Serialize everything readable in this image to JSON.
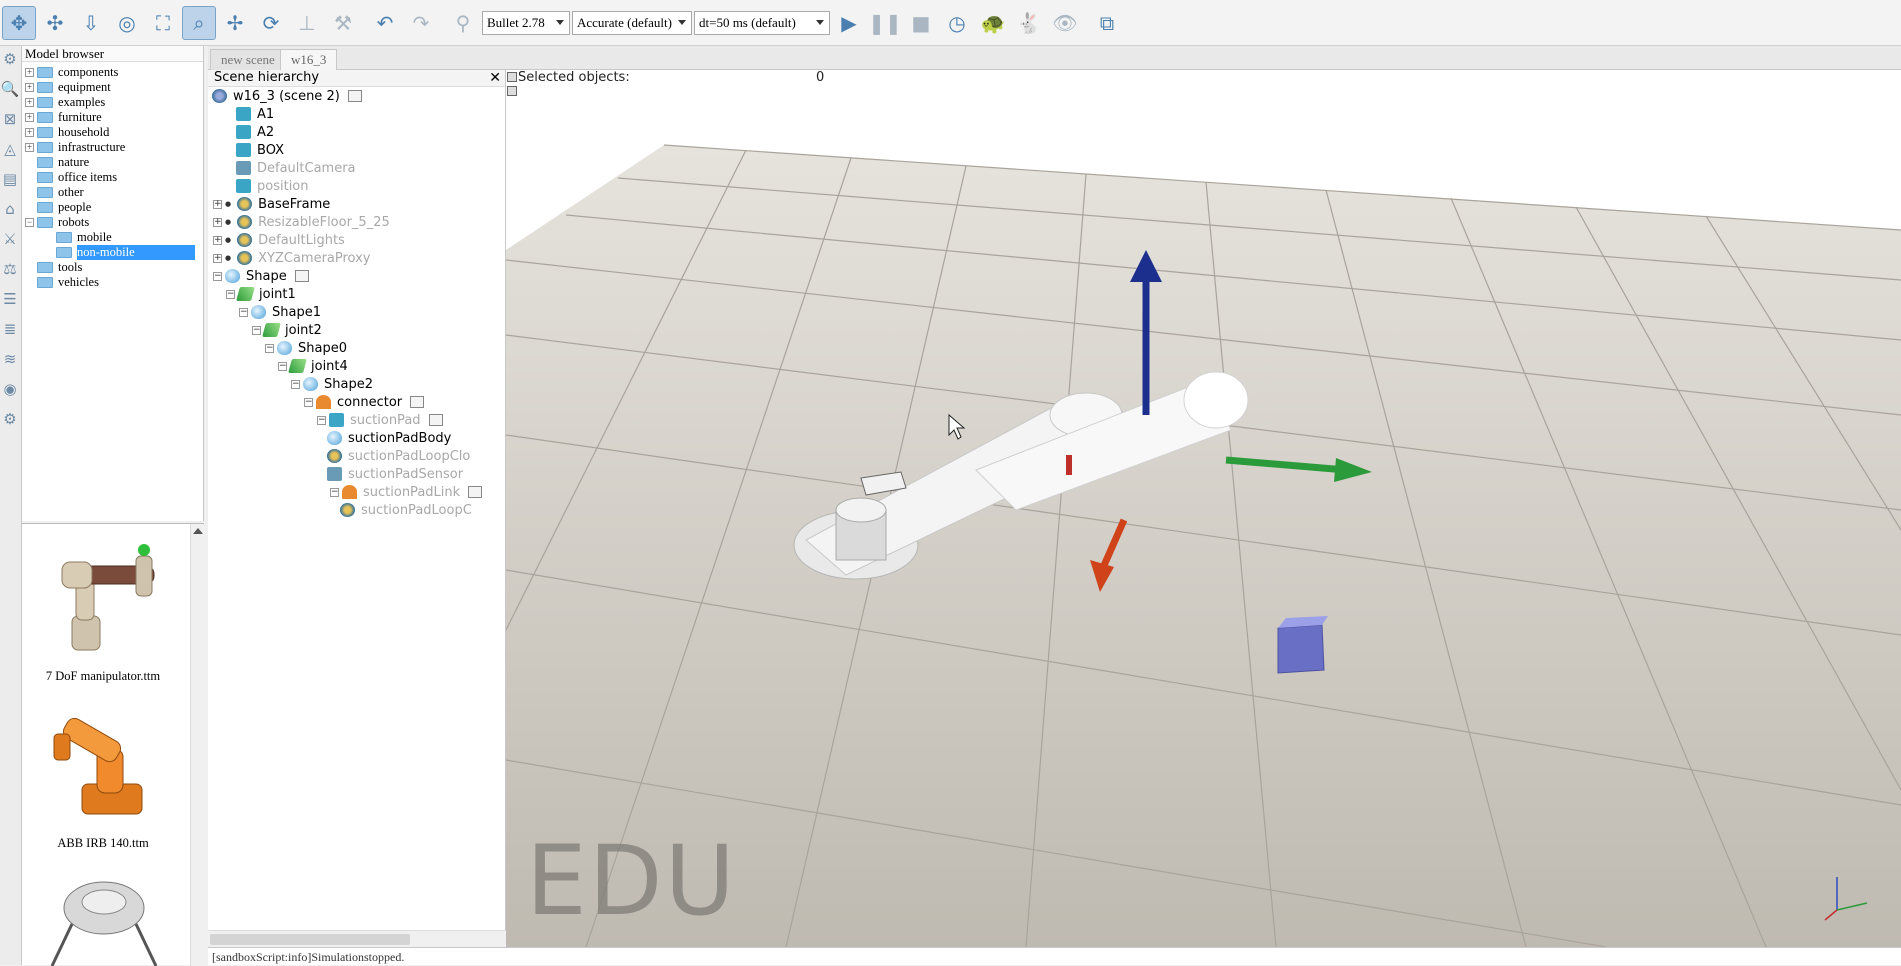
{
  "toolbar": {
    "engine": "Bullet 2.78",
    "accuracy": "Accurate (default)",
    "timestep": "dt=50 ms (default)"
  },
  "model_browser": {
    "title": "Model browser",
    "folders": [
      {
        "label": "components",
        "expandable": true
      },
      {
        "label": "equipment",
        "expandable": true
      },
      {
        "label": "examples",
        "expandable": true
      },
      {
        "label": "furniture",
        "expandable": true
      },
      {
        "label": "household",
        "expandable": true
      },
      {
        "label": "infrastructure",
        "expandable": true
      },
      {
        "label": "nature",
        "expandable": false
      },
      {
        "label": "office items",
        "expandable": false
      },
      {
        "label": "other",
        "expandable": false
      },
      {
        "label": "people",
        "expandable": false
      },
      {
        "label": "robots",
        "expandable": true,
        "expanded": true
      },
      {
        "label": "mobile",
        "child": true
      },
      {
        "label": "non-mobile",
        "child": true,
        "selected": true
      },
      {
        "label": "tools",
        "expandable": false
      },
      {
        "label": "vehicles",
        "expandable": false
      }
    ],
    "previews": [
      {
        "label": "7 DoF manipulator.ttm"
      },
      {
        "label": "ABB IRB 140.ttm"
      }
    ]
  },
  "tabs": [
    "new scene",
    "w16_3"
  ],
  "scene_hierarchy": {
    "title": "Scene hierarchy",
    "root": "w16_3 (scene 2)",
    "items": [
      {
        "label": "A1",
        "icon": "cube",
        "depth": 0
      },
      {
        "label": "A2",
        "icon": "cube",
        "depth": 0
      },
      {
        "label": "BOX",
        "icon": "cube",
        "depth": 0
      },
      {
        "label": "DefaultCamera",
        "icon": "camera",
        "depth": 0,
        "grey": true
      },
      {
        "label": "position",
        "icon": "cube",
        "depth": 0,
        "grey": true
      },
      {
        "label": "BaseFrame",
        "icon": "model",
        "depth": 0
      },
      {
        "label": "ResizableFloor_5_25",
        "icon": "model",
        "depth": 0,
        "grey": true
      },
      {
        "label": "DefaultLights",
        "icon": "model",
        "depth": 0,
        "grey": true
      },
      {
        "label": "XYZCameraProxy",
        "icon": "model",
        "depth": 0,
        "grey": true
      },
      {
        "label": "Shape",
        "icon": "shape",
        "depth": 0
      },
      {
        "label": "joint1",
        "icon": "joint",
        "depth": 1
      },
      {
        "label": "Shape1",
        "icon": "shape",
        "depth": 2
      },
      {
        "label": "joint2",
        "icon": "joint",
        "depth": 3
      },
      {
        "label": "Shape0",
        "icon": "shape",
        "depth": 4
      },
      {
        "label": "joint4",
        "icon": "joint",
        "depth": 5
      },
      {
        "label": "Shape2",
        "icon": "shape",
        "depth": 6
      },
      {
        "label": "connector",
        "icon": "dummy",
        "depth": 7
      },
      {
        "label": "suctionPad",
        "icon": "cube",
        "depth": 8,
        "grey": true
      },
      {
        "label": "suctionPadBody",
        "icon": "shape",
        "depth": 9
      },
      {
        "label": "suctionPadLoopClo",
        "icon": "model",
        "depth": 9,
        "grey": true
      },
      {
        "label": "suctionPadSensor",
        "icon": "sensor",
        "depth": 9,
        "grey": true
      },
      {
        "label": "suctionPadLink",
        "icon": "dummy",
        "depth": 9,
        "grey": true
      },
      {
        "label": "suctionPadLoopC",
        "icon": "model",
        "depth": 10,
        "grey": true
      }
    ]
  },
  "viewport": {
    "selected_label": "Selected objects:",
    "selected_count": "0",
    "watermark": "EDU"
  },
  "status": "[sandboxScript:info]Simulationstopped."
}
